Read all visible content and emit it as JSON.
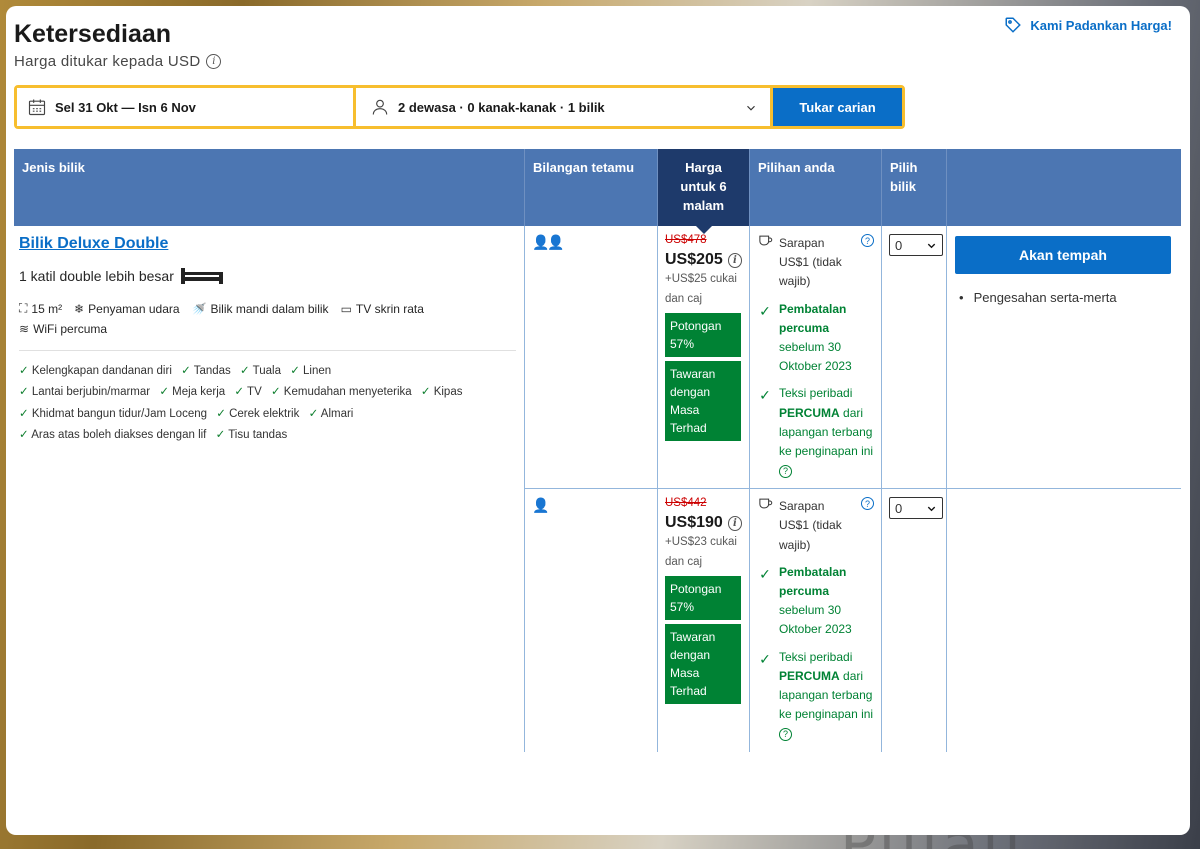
{
  "header": {
    "title": "Ketersediaan",
    "subtitle": "Harga ditukar kepada USD",
    "price_match": "Kami Padankan Harga!"
  },
  "search": {
    "dates": "Sel 31 Okt — Isn 6 Nov",
    "guests": "2 dewasa · 0 kanak-kanak · 1 bilik",
    "button": "Tukar carian"
  },
  "table": {
    "headers": {
      "room_type": "Jenis bilik",
      "guests": "Bilangan tetamu",
      "price": "Harga untuk 6 malam",
      "choices": "Pilihan anda",
      "select": "Pilih bilik"
    }
  },
  "room": {
    "name": "Bilik Deluxe Double",
    "bed": "1 katil double lebih besar",
    "facilities": [
      {
        "icon": "room-size-icon",
        "glyph": "⛶",
        "label": "15 m²"
      },
      {
        "icon": "snowflake-icon",
        "glyph": "❄",
        "label": "Penyaman udara"
      },
      {
        "icon": "shower-icon",
        "glyph": "🚿",
        "label": "Bilik mandi dalam bilik"
      },
      {
        "icon": "tv-icon",
        "glyph": "▭",
        "label": "TV skrin rata"
      },
      {
        "icon": "wifi-icon",
        "glyph": "≋",
        "label": "WiFi percuma"
      }
    ],
    "amenities": [
      "Kelengkapan dandanan diri",
      "Tandas",
      "Tuala",
      "Linen",
      "Lantai berjubin/marmar",
      "Meja kerja",
      "TV",
      "Kemudahan menyeterika",
      "Kipas",
      "Khidmat bangun tidur/Jam Loceng",
      "Cerek elektrik",
      "Almari",
      "Aras atas boleh diakses dengan lif",
      "Tisu tandas"
    ]
  },
  "options": [
    {
      "persons": "👤👤",
      "old_price": "US$478",
      "price": "US$205",
      "tax": "+US$25 cukai dan caj",
      "discount": "Potongan 57%",
      "deal": "Tawaran dengan Masa Terhad",
      "breakfast": "Sarapan US$1 (tidak wajib)",
      "cancel_bold": "Pembatalan percuma",
      "cancel_rest": "sebelum 30 Oktober 2023",
      "taxi_pre": "Teksi peribadi",
      "taxi_bold": "PERCUMA",
      "taxi_rest": "dari lapangan terbang ke penginapan ini",
      "qty": "0"
    },
    {
      "persons": "👤",
      "old_price": "US$442",
      "price": "US$190",
      "tax": "+US$23 cukai dan caj",
      "discount": "Potongan 57%",
      "deal": "Tawaran dengan Masa Terhad",
      "breakfast": "Sarapan US$1 (tidak wajib)",
      "cancel_bold": "Pembatalan percuma",
      "cancel_rest": "sebelum 30 Oktober 2023",
      "taxi_pre": "Teksi peribadi",
      "taxi_bold": "PERCUMA",
      "taxi_rest": "dari lapangan terbang ke penginapan ini",
      "qty": "0"
    }
  ],
  "booking": {
    "button": "Akan tempah",
    "note": "Pengesahan serta-merta"
  },
  "background_text": "Pulau",
  "colors": {
    "primary": "#0a6ec7",
    "header": "#4c76b2",
    "header_active": "#1e3a6b",
    "green": "#008234",
    "search_border": "#f7be2e"
  }
}
